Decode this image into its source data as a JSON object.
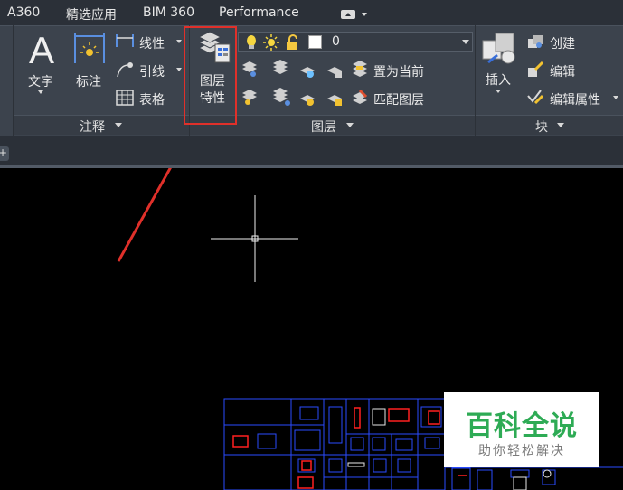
{
  "menubar": {
    "tabs": [
      "A360",
      "精选应用",
      "BIM 360",
      "Performance"
    ]
  },
  "ribbon": {
    "annotation_panel": {
      "title": "注释",
      "text_button": "文字",
      "dimension_button": "标注",
      "linear_button": "线性",
      "leader_button": "引线",
      "table_button": "表格"
    },
    "layers_panel": {
      "title": "图层",
      "layer_properties_line1": "图层",
      "layer_properties_line2": "特性",
      "current_layer": "0",
      "set_current_button": "置为当前",
      "match_layer_button": "匹配图层"
    },
    "block_panel": {
      "title": "块",
      "insert_button": "插入",
      "create_button": "创建",
      "edit_button": "编辑",
      "edit_attributes_button": "编辑属性"
    }
  },
  "tabstrip": {
    "plus": "+"
  },
  "watermark": {
    "title": "百科全说",
    "subtitle": "助你轻松解决"
  },
  "colors": {
    "ribbon_bg": "#3c434d",
    "menubar_bg": "#2b3038",
    "canvas_bg": "#000000",
    "highlight": "#e0302a",
    "drawing_blue": "#2a4bff",
    "drawing_red": "#ff2020",
    "watermark_green": "#2eab55"
  }
}
